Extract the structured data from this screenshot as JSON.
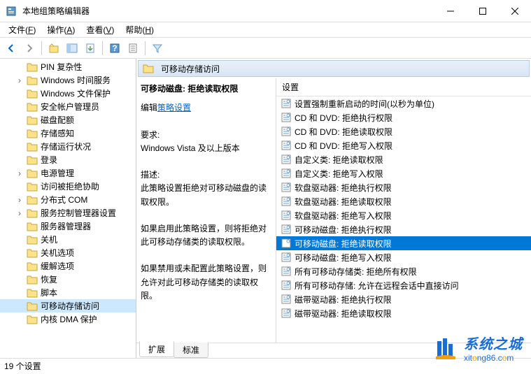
{
  "window": {
    "title": "本地组策略编辑器"
  },
  "menu": [
    "文件(F)",
    "操作(A)",
    "查看(V)",
    "帮助(H)"
  ],
  "tree": [
    {
      "label": "PIN 复杂性",
      "arrow": ""
    },
    {
      "label": "Windows 时间服务",
      "arrow": "›"
    },
    {
      "label": "Windows 文件保护",
      "arrow": ""
    },
    {
      "label": "安全帐户管理员",
      "arrow": ""
    },
    {
      "label": "磁盘配额",
      "arrow": ""
    },
    {
      "label": "存储感知",
      "arrow": ""
    },
    {
      "label": "存储运行状况",
      "arrow": ""
    },
    {
      "label": "登录",
      "arrow": ""
    },
    {
      "label": "电源管理",
      "arrow": "›"
    },
    {
      "label": "访问被拒绝协助",
      "arrow": ""
    },
    {
      "label": "分布式 COM",
      "arrow": "›"
    },
    {
      "label": "服务控制管理器设置",
      "arrow": "›"
    },
    {
      "label": "服务器管理器",
      "arrow": ""
    },
    {
      "label": "关机",
      "arrow": ""
    },
    {
      "label": "关机选项",
      "arrow": ""
    },
    {
      "label": "缓解选项",
      "arrow": ""
    },
    {
      "label": "恢复",
      "arrow": ""
    },
    {
      "label": "脚本",
      "arrow": ""
    },
    {
      "label": "可移动存储访问",
      "arrow": "",
      "sel": true
    },
    {
      "label": "内核 DMA 保护",
      "arrow": ""
    }
  ],
  "header": "可移动存储访问",
  "desc": {
    "title": "可移动磁盘: 拒绝读取权限",
    "edit_prefix": "编辑",
    "edit_link": "策略设置",
    "req_label": "要求:",
    "req_text": "Windows Vista 及以上版本",
    "desc_label": "描述:",
    "desc_text": "此策略设置拒绝对可移动磁盘的读取权限。",
    "p1": "如果启用此策略设置，则将拒绝对此可移动存储类的读取权限。",
    "p2": "如果禁用或未配置此策略设置，则允许对此可移动存储类的读取权限。"
  },
  "col": "设置",
  "settings": [
    "设置强制重新启动的时间(以秒为单位)",
    "CD 和 DVD: 拒绝执行权限",
    "CD 和 DVD: 拒绝读取权限",
    "CD 和 DVD: 拒绝写入权限",
    "自定义类: 拒绝读取权限",
    "自定义类: 拒绝写入权限",
    "软盘驱动器: 拒绝执行权限",
    "软盘驱动器: 拒绝读取权限",
    "软盘驱动器: 拒绝写入权限",
    "可移动磁盘: 拒绝执行权限",
    "可移动磁盘: 拒绝读取权限",
    "可移动磁盘: 拒绝写入权限",
    "所有可移动存储类: 拒绝所有权限",
    "所有可移动存储: 允许在远程会话中直接访问",
    "磁带驱动器: 拒绝执行权限",
    "磁带驱动器: 拒绝读取权限"
  ],
  "settings_selected": 10,
  "tabs": [
    "扩展",
    "标准"
  ],
  "status": "19 个设置",
  "watermark": {
    "cn": "系统之城",
    "en_pre": "xitong86",
    "en_dot": ".",
    "en_c": "c",
    "en_om": "om"
  }
}
